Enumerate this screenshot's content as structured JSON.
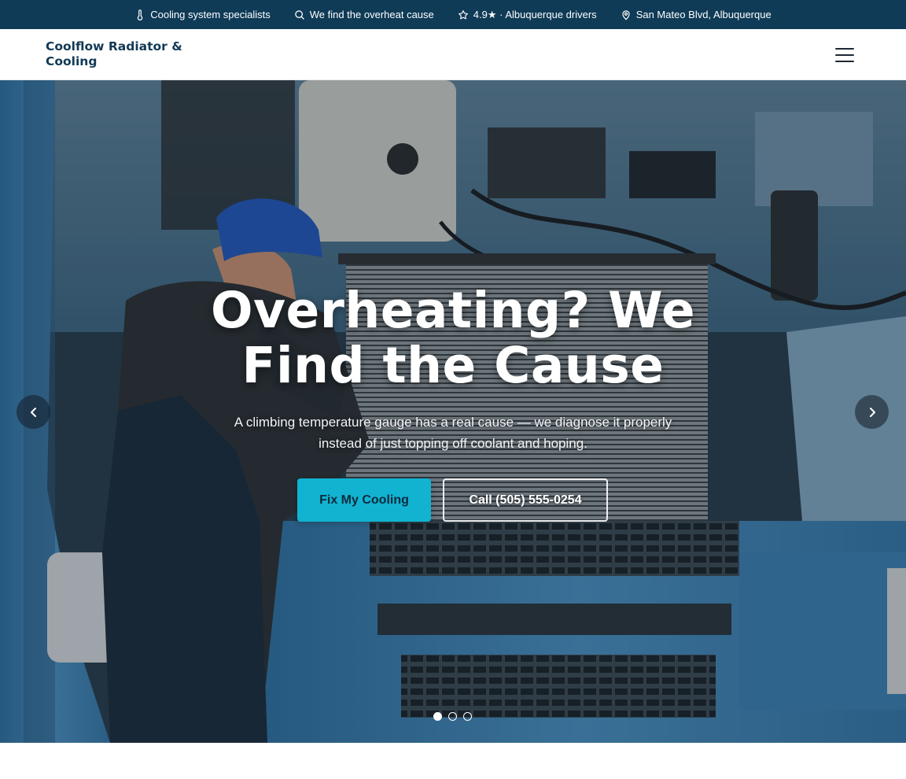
{
  "topbar": {
    "items": [
      {
        "icon": "thermometer-icon",
        "label": "Cooling system specialists"
      },
      {
        "icon": "search-icon",
        "label": "We find the overheat cause"
      },
      {
        "icon": "star-icon",
        "label": "4.9★ · Albuquerque drivers"
      },
      {
        "icon": "map-pin-icon",
        "label": "San Mateo Blvd, Albuquerque"
      }
    ]
  },
  "header": {
    "brand": "Coolflow Radiator & Cooling",
    "menu_icon": "hamburger-menu-icon"
  },
  "hero": {
    "title": "Overheating? We Find the Cause",
    "subtitle": "A climbing temperature gauge has a real cause — we diagnose it properly instead of just topping off coolant and hoping.",
    "primary_cta": "Fix My Cooling",
    "secondary_cta": "Call (505) 555-0254",
    "prev_icon": "chevron-left-icon",
    "next_icon": "chevron-right-icon",
    "slides": {
      "count": 3,
      "active": 1
    }
  },
  "colors": {
    "topbar_bg": "#0f3b57",
    "brand_text": "#133a56",
    "primary_button": "#11b3d1",
    "truck_blue": "#3f7fae"
  }
}
